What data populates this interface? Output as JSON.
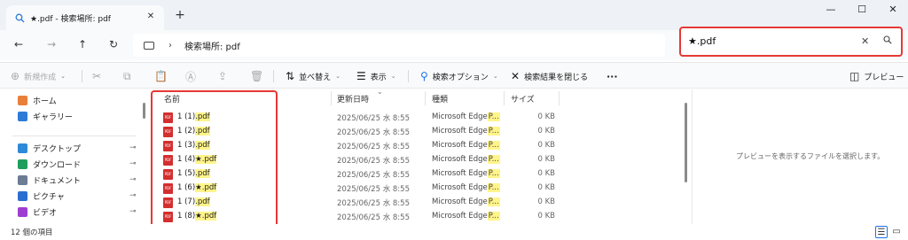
{
  "tab": {
    "title": "★.pdf - 検索場所: pdf",
    "close": "✕"
  },
  "new_tab": "+",
  "window": {
    "minimize": "—",
    "maximize": "☐",
    "close": "✕"
  },
  "nav": {
    "back": "←",
    "forward": "→",
    "up": "↑",
    "refresh": "↻",
    "chevron": "›"
  },
  "address": {
    "text": "検索場所: pdf"
  },
  "search": {
    "value": "★.pdf",
    "clear": "✕",
    "search_glyph": "⚲"
  },
  "commands": {
    "new": "新規作成",
    "sort": "並べ替え",
    "view": "表示",
    "search_options": "検索オプション",
    "close_search": "検索結果を閉じる",
    "more": "···",
    "preview": "プレビュー"
  },
  "sidebar": {
    "top": [
      {
        "label": "ホーム",
        "color": "#e8803a"
      },
      {
        "label": "ギャラリー",
        "color": "#2e7bd6"
      }
    ],
    "pinned": [
      {
        "label": "デスクトップ",
        "color": "#2c8ad8"
      },
      {
        "label": "ダウンロード",
        "color": "#1e9e5c"
      },
      {
        "label": "ドキュメント",
        "color": "#6b7c93"
      },
      {
        "label": "ピクチャ",
        "color": "#2a6fcf"
      },
      {
        "label": "ビデオ",
        "color": "#9c3fd0"
      }
    ],
    "pin_glyph": "📌"
  },
  "columns": {
    "name": "名前",
    "date": "更新日時",
    "type": "種類",
    "size": "サイズ"
  },
  "files": [
    {
      "prefix": "1 (1)",
      "hl": ".pdf",
      "date": "2025/06/25 水 8:55",
      "type": "Microsoft Edge",
      "type_hl": "P...",
      "size": "0 KB"
    },
    {
      "prefix": "1 (2)",
      "hl": ".pdf",
      "date": "2025/06/25 水 8:55",
      "type": "Microsoft Edge",
      "type_hl": "P...",
      "size": "0 KB"
    },
    {
      "prefix": "1 (3)",
      "hl": ".pdf",
      "date": "2025/06/25 水 8:55",
      "type": "Microsoft Edge",
      "type_hl": "P...",
      "size": "0 KB"
    },
    {
      "prefix": "1 (4)",
      "hl": "★.pdf",
      "date": "2025/06/25 水 8:55",
      "type": "Microsoft Edge",
      "type_hl": "P...",
      "size": "0 KB"
    },
    {
      "prefix": "1 (5)",
      "hl": ".pdf",
      "date": "2025/06/25 水 8:55",
      "type": "Microsoft Edge",
      "type_hl": "P...",
      "size": "0 KB"
    },
    {
      "prefix": "1 (6)",
      "hl": "★.pdf",
      "date": "2025/06/25 水 8:55",
      "type": "Microsoft Edge",
      "type_hl": "P...",
      "size": "0 KB"
    },
    {
      "prefix": "1 (7)",
      "hl": ".pdf",
      "date": "2025/06/25 水 8:55",
      "type": "Microsoft Edge",
      "type_hl": "P...",
      "size": "0 KB"
    },
    {
      "prefix": "1 (8)",
      "hl": "★.pdf",
      "date": "2025/06/25 水 8:55",
      "type": "Microsoft Edge",
      "type_hl": "P...",
      "size": "0 KB"
    }
  ],
  "preview_message": "プレビューを表示するファイルを選択します。",
  "status": {
    "count": "12 個の項目"
  },
  "colors": {
    "search_outline": "#e53935",
    "highlight": "#fff48a",
    "pdf_icon": "#d32f2f",
    "accent": "#1a73e8"
  }
}
